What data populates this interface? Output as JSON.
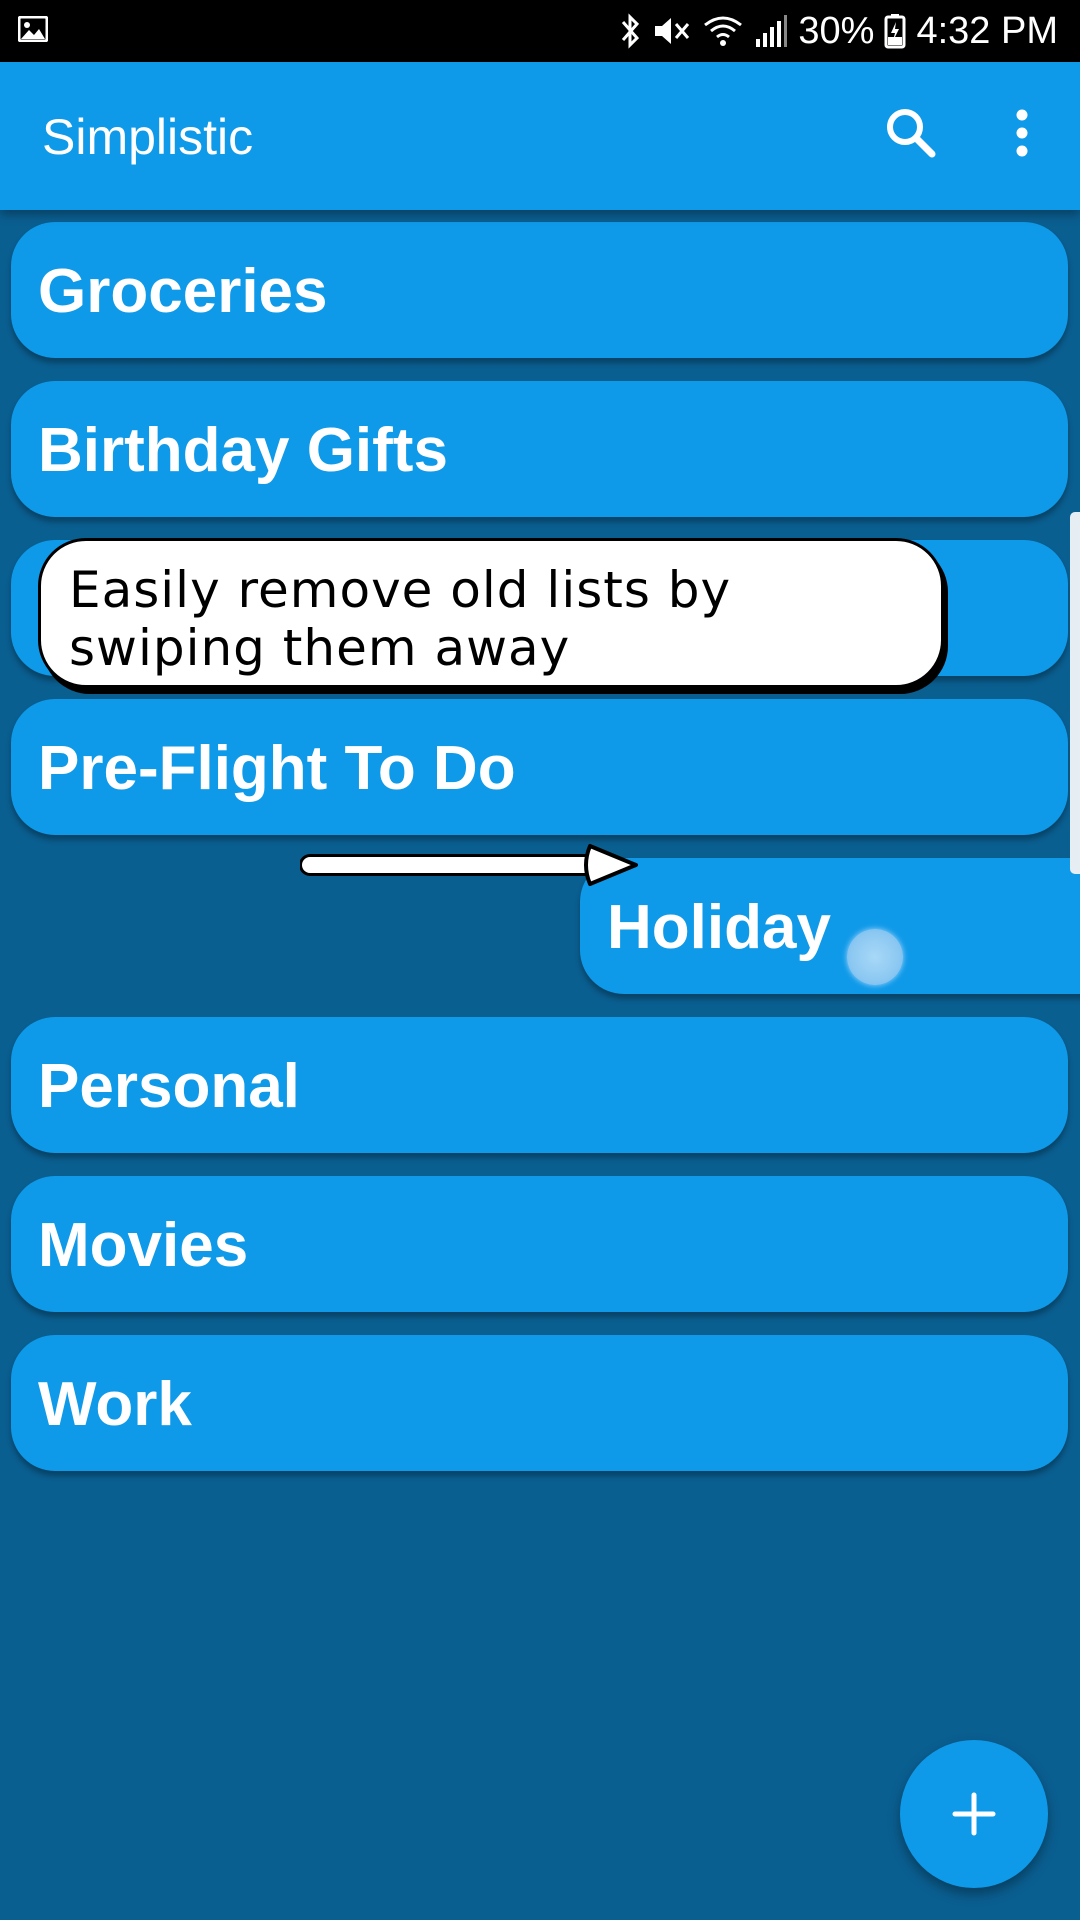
{
  "status_bar": {
    "battery": "30%",
    "time": "4:32 PM",
    "icons": [
      "image-icon",
      "bluetooth-icon",
      "mute-icon",
      "wifi-icon",
      "signal-icon",
      "battery-icon"
    ]
  },
  "app_bar": {
    "title": "Simplistic",
    "icons": [
      "search-icon",
      "more-vert-icon"
    ]
  },
  "lists": [
    {
      "label": "Groceries"
    },
    {
      "label": "Birthday Gifts"
    },
    {
      "label": ""
    },
    {
      "label": "Pre-Flight To Do"
    },
    {
      "label": "Holiday",
      "state": "swiping"
    },
    {
      "label": "Personal"
    },
    {
      "label": "Movies"
    },
    {
      "label": "Work"
    }
  ],
  "tooltip": {
    "text": "Easily remove old lists by swiping them away"
  },
  "fab": {
    "icon": "plus-icon"
  },
  "colors": {
    "background": "#0a5f91",
    "primary": "#0f9ae9",
    "text": "#ffffff"
  }
}
